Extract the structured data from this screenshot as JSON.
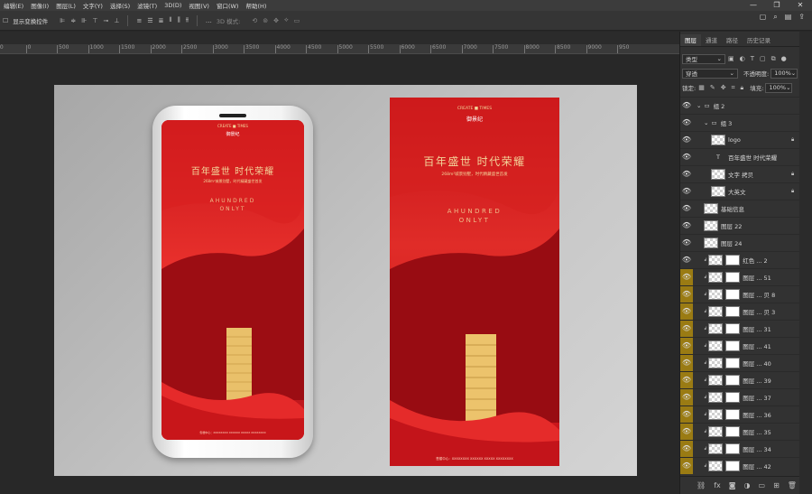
{
  "menubar": {
    "items": [
      "编辑(E)",
      "图像(I)",
      "图层(L)",
      "文字(Y)",
      "选择(S)",
      "滤镜(T)",
      "3D(D)",
      "视图(V)",
      "窗口(W)",
      "帮助(H)"
    ],
    "window_controls": [
      "—",
      "❐",
      "✕"
    ]
  },
  "options_bar": {
    "transform_controls_label": "显示变换控件",
    "mode_3d_label": "3D 模式:",
    "more_icon": "…",
    "right_icons": [
      "window-icon",
      "search-icon",
      "layout-icon",
      "share-icon"
    ]
  },
  "ruler": {
    "ticks": [
      "50",
      "0",
      "500",
      "1000",
      "1500",
      "2000",
      "2500",
      "3000",
      "3500",
      "4000",
      "4500",
      "5000",
      "5500",
      "6000",
      "6500",
      "7000",
      "7500",
      "8000",
      "8500",
      "9000",
      "950"
    ]
  },
  "panel": {
    "tabs": [
      "图层",
      "通道",
      "路径",
      "历史记录"
    ],
    "active_tab": "图层",
    "kind_select": "类型",
    "filter_icons": [
      "image-filter-icon",
      "adjust-filter-icon",
      "type-filter-icon",
      "shape-filter-icon",
      "smart-filter-icon"
    ],
    "blend_mode": "穿透",
    "opacity_label": "不透明度:",
    "opacity_value": "100%",
    "lock_label": "锁定:",
    "fill_label": "填充:",
    "fill_value": "100%",
    "bottom_icons": [
      "link-icon",
      "fx-icon",
      "mask-icon",
      "adjustment-icon",
      "folder-icon",
      "new-layer-icon",
      "trash-icon"
    ]
  },
  "layers": [
    {
      "name": "组 2",
      "type": "group",
      "indent": 0,
      "eye": "plain"
    },
    {
      "name": "组 3",
      "type": "group",
      "indent": 1,
      "eye": "plain"
    },
    {
      "name": "logo",
      "type": "layer",
      "indent": 2,
      "eye": "plain",
      "lock": true
    },
    {
      "name": "百年盛世 时代荣耀",
      "type": "text",
      "indent": 2,
      "eye": "plain"
    },
    {
      "name": "文字 拷贝",
      "type": "layer",
      "indent": 2,
      "eye": "plain",
      "lock": true
    },
    {
      "name": "大英文",
      "type": "layer",
      "indent": 2,
      "eye": "plain",
      "lock": true
    },
    {
      "name": "基础信息",
      "type": "layer",
      "indent": 1,
      "eye": "plain"
    },
    {
      "name": "图层 22",
      "type": "layer",
      "indent": 1,
      "eye": "plain"
    },
    {
      "name": "图层 24",
      "type": "layer",
      "indent": 1,
      "eye": "plain"
    },
    {
      "name": "红色 ... 2",
      "type": "masked",
      "indent": 1,
      "eye": "plain"
    },
    {
      "name": "图层 ... 51",
      "type": "masked",
      "indent": 1,
      "eye": "yellow"
    },
    {
      "name": "图层 ... 贝 8",
      "type": "masked",
      "indent": 1,
      "eye": "yellow"
    },
    {
      "name": "图层 ... 贝 3",
      "type": "masked",
      "indent": 1,
      "eye": "yellow"
    },
    {
      "name": "图层 ... 31",
      "type": "masked",
      "indent": 1,
      "eye": "yellow"
    },
    {
      "name": "图层 ... 41",
      "type": "masked",
      "indent": 1,
      "eye": "yellow"
    },
    {
      "name": "图层 ... 40",
      "type": "masked",
      "indent": 1,
      "eye": "yellow"
    },
    {
      "name": "图层 ... 39",
      "type": "masked",
      "indent": 1,
      "eye": "yellow"
    },
    {
      "name": "图层 ... 37",
      "type": "masked",
      "indent": 1,
      "eye": "yellow"
    },
    {
      "name": "图层 ... 36",
      "type": "masked",
      "indent": 1,
      "eye": "yellow"
    },
    {
      "name": "图层 ... 35",
      "type": "masked",
      "indent": 1,
      "eye": "yellow"
    },
    {
      "name": "图层 ... 34",
      "type": "masked",
      "indent": 1,
      "eye": "yellow"
    },
    {
      "name": "图层 ... 42",
      "type": "masked",
      "indent": 1,
      "eye": "yellow"
    }
  ],
  "poster": {
    "brand_top": "CREATE ■ TIMES",
    "brand_name": "御景纪",
    "headline": "百年盛世  时代荣耀",
    "subline": "268m²城景别墅，时代精藏盛世首发",
    "english_1": "AHUNDRED",
    "english_2": "ONLYT",
    "footer": "售楼中心：XXXXXXXX  XXXXXX  XXXXX  XXXXXXXX"
  },
  "colors": {
    "poster_red": "#d01a1d",
    "poster_dark": "#8c0c10",
    "gold": "#f3d59a",
    "highlight": "#9a7b13"
  }
}
